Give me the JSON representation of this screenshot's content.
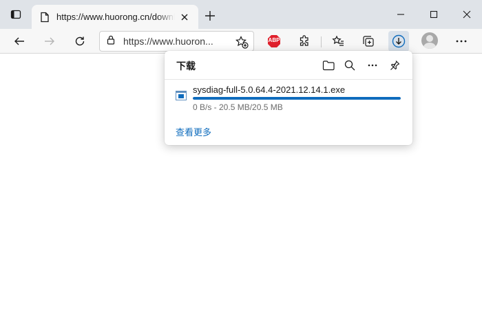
{
  "tab": {
    "title": "https://www.huorong.cn/download",
    "active": true
  },
  "address_bar": {
    "url": "https://www.huoron..."
  },
  "toolbar": {
    "extensions": [
      "abp-icon",
      "extensions-puzzle-icon"
    ],
    "accent_color": "#0f6cbd"
  },
  "downloads_panel": {
    "title": "下载",
    "item": {
      "filename": "sysdiag-full-5.0.64.4-2021.12.14.1.exe",
      "status": "0 B/s - 20.5 MB/20.5 MB",
      "progress_fraction": 1.0
    },
    "see_more_label": "查看更多"
  },
  "abp": {
    "label": "ABP",
    "color": "#e0202c"
  }
}
